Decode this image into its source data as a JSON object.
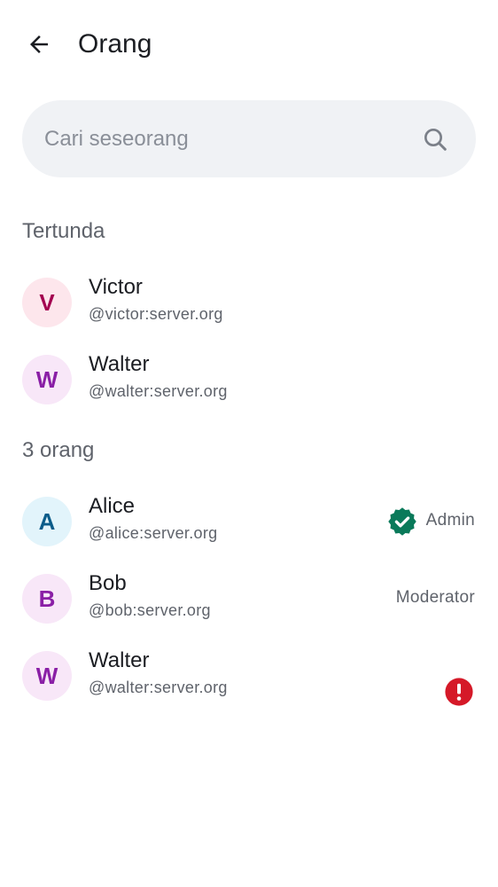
{
  "header": {
    "back_icon": "arrow-left-icon",
    "title": "Orang"
  },
  "search": {
    "placeholder": "Cari seseorang",
    "value": "",
    "icon": "search-icon"
  },
  "pending": {
    "heading": "Tertunda",
    "members": [
      {
        "initial": "V",
        "name": "Victor",
        "handle": "@victor:server.org",
        "avatar_bg": "#fde6ec",
        "avatar_fg": "#a3004f"
      },
      {
        "initial": "W",
        "name": "Walter",
        "handle": "@walter:server.org",
        "avatar_bg": "#f8e7f8",
        "avatar_fg": "#8a1fa6"
      }
    ]
  },
  "joined": {
    "heading": "3 orang",
    "members": [
      {
        "initial": "A",
        "name": "Alice",
        "handle": "@alice:server.org",
        "role": "Admin",
        "badge": "verified-shield-icon",
        "avatar_bg": "#e2f4fb",
        "avatar_fg": "#0a5c8a"
      },
      {
        "initial": "B",
        "name": "Bob",
        "handle": "@bob:server.org",
        "role": "Moderator",
        "avatar_bg": "#f8e7f8",
        "avatar_fg": "#8a1fa6"
      },
      {
        "initial": "W",
        "name": "Walter",
        "handle": "@walter:server.org",
        "badge": "error-icon",
        "avatar_bg": "#f8e7f8",
        "avatar_fg": "#8a1fa6"
      }
    ]
  },
  "colors": {
    "verified": "#0a7a5a",
    "error": "#d51928",
    "search_bg": "#f0f2f5"
  }
}
